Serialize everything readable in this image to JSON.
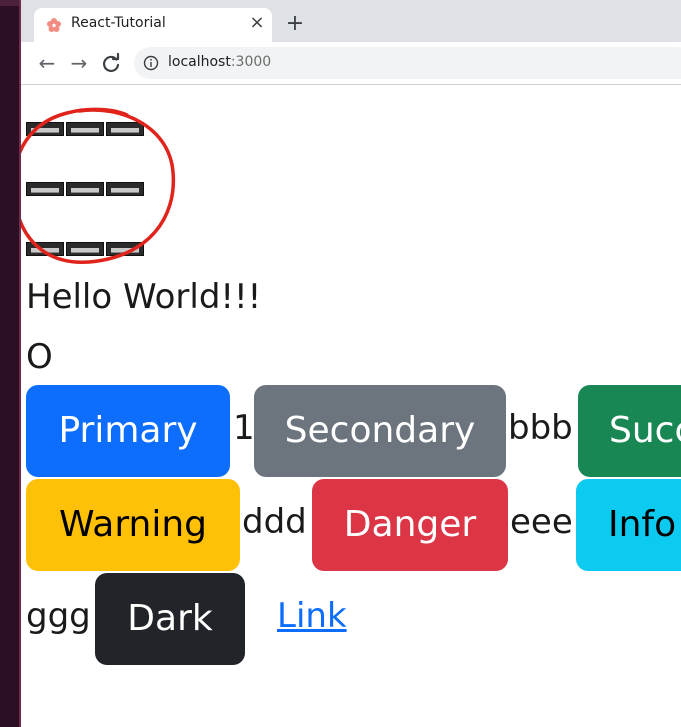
{
  "browser": {
    "tab_title": "React-Tutorial",
    "tab_close": "×",
    "new_tab": "+",
    "back": "←",
    "forward": "→",
    "reload": "C",
    "url_host": "localhost",
    "url_port": ":3000"
  },
  "content": {
    "heading": "Hello World!!!",
    "letter": "O",
    "rows": [
      {
        "buttons": [
          "Primary",
          "Secondary",
          "Succ"
        ],
        "texts": [
          "1",
          "bbb"
        ]
      },
      {
        "buttons": [
          "Warning",
          "Danger",
          "Info"
        ],
        "texts": [
          "ddd",
          "eee"
        ]
      },
      {
        "buttons": [
          "Dark"
        ],
        "texts": [
          "ggg"
        ],
        "link": "Link"
      }
    ]
  },
  "colors": {
    "primary": "#0d6efd",
    "secondary": "#6c757d",
    "success": "#198754",
    "warning": "#ffc107",
    "danger": "#dc3545",
    "info": "#0dcaf0",
    "dark": "#212529",
    "annotation": "#e0241c"
  }
}
